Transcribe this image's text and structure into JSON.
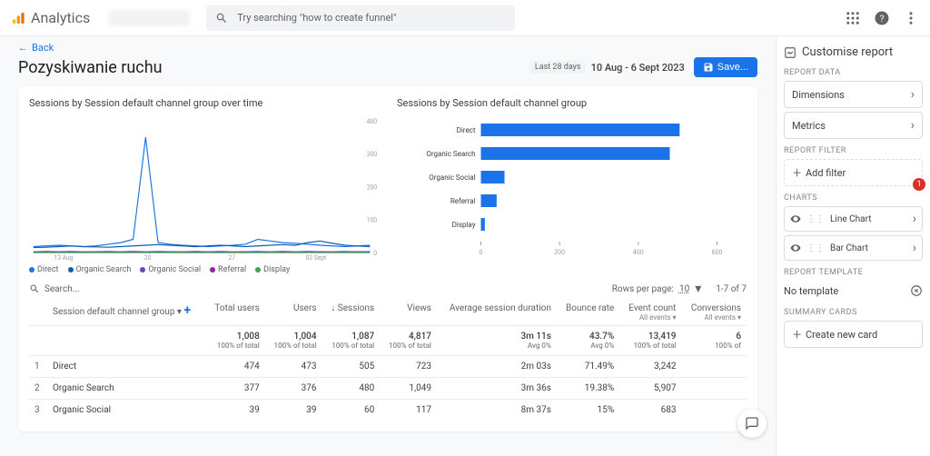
{
  "header": {
    "app_name": "Analytics",
    "search_placeholder": "Try searching \"how to create funnel\""
  },
  "nav": {
    "back_label": "Back"
  },
  "page": {
    "title": "Pozyskiwanie ruchu",
    "date_chip": "Last 28 days",
    "date_range": "10 Aug - 6 Sept 2023",
    "save_label": "Save..."
  },
  "charts": {
    "line_title": "Sessions by Session default channel group over time",
    "bar_title": "Sessions by Session default channel group",
    "legend": [
      "Direct",
      "Organic Search",
      "Organic Social",
      "Referral",
      "Display"
    ],
    "legend_colors": [
      "#1a73e8",
      "#0f5bb5",
      "#6f42c1",
      "#8e24aa",
      "#34a853"
    ]
  },
  "table": {
    "search_placeholder": "Search...",
    "rows_per_page_label": "Rows per page:",
    "rows_per_page_value": "10",
    "page_info": "1-7 of 7",
    "dimension_header": "Session default channel group",
    "columns": [
      "Total users",
      "Users",
      "↓ Sessions",
      "Views",
      "Average session duration",
      "Bounce rate",
      "Event count",
      "Conversions"
    ],
    "sub_headers": [
      "",
      "",
      "",
      "",
      "",
      "",
      "All events",
      "All events"
    ],
    "totals": {
      "values": [
        "1,008",
        "1,004",
        "1,087",
        "4,817",
        "3m 11s",
        "43.7%",
        "13,419",
        "6"
      ],
      "subs": [
        "100% of total",
        "100% of total",
        "100% of total",
        "100% of total",
        "Avg 0%",
        "Avg 0%",
        "100% of total",
        "100% of"
      ]
    },
    "rows": [
      {
        "idx": "1",
        "dim": "Direct",
        "vals": [
          "474",
          "473",
          "505",
          "723",
          "2m 03s",
          "71.49%",
          "3,242",
          ""
        ]
      },
      {
        "idx": "2",
        "dim": "Organic Search",
        "vals": [
          "377",
          "376",
          "480",
          "1,049",
          "3m 36s",
          "19.38%",
          "5,907",
          ""
        ]
      },
      {
        "idx": "3",
        "dim": "Organic Social",
        "vals": [
          "39",
          "39",
          "60",
          "117",
          "8m 37s",
          "15%",
          "683",
          ""
        ]
      }
    ]
  },
  "sidebar": {
    "title": "Customise report",
    "section_data": "REPORT DATA",
    "dimensions": "Dimensions",
    "metrics": "Metrics",
    "section_filter": "REPORT FILTER",
    "add_filter": "Add filter",
    "badge": "1",
    "section_charts": "CHARTS",
    "chart_line": "Line Chart",
    "chart_bar": "Bar Chart",
    "section_template": "REPORT TEMPLATE",
    "no_template": "No template",
    "section_summary": "SUMMARY CARDS",
    "create_card": "Create new card"
  },
  "chart_data": [
    {
      "type": "line",
      "title": "Sessions by Session default channel group over time",
      "xlabel": "",
      "ylabel": "",
      "ylim": [
        0,
        400
      ],
      "x_ticks": [
        "13 Aug",
        "20",
        "27",
        "03 Sept"
      ],
      "series": [
        {
          "name": "Direct",
          "color": "#1a73e8",
          "values": [
            18,
            20,
            22,
            20,
            18,
            20,
            25,
            30,
            40,
            350,
            30,
            25,
            22,
            20,
            18,
            20,
            22,
            25,
            40,
            35,
            30,
            28,
            25,
            22,
            20,
            18,
            20,
            22
          ]
        },
        {
          "name": "Organic Search",
          "color": "#0f5bb5",
          "values": [
            15,
            16,
            18,
            20,
            18,
            17,
            16,
            18,
            20,
            22,
            24,
            22,
            20,
            18,
            20,
            22,
            20,
            18,
            20,
            22,
            24,
            22,
            30,
            35,
            28,
            22,
            20,
            18
          ]
        },
        {
          "name": "Organic Social",
          "color": "#6f42c1",
          "values": [
            2,
            3,
            2,
            3,
            2,
            2,
            3,
            2,
            3,
            2,
            3,
            2,
            2,
            3,
            2,
            3,
            2,
            2,
            3,
            2,
            3,
            2,
            3,
            2,
            2,
            3,
            2,
            3
          ]
        },
        {
          "name": "Referral",
          "color": "#8e24aa",
          "values": [
            1,
            1,
            2,
            1,
            1,
            2,
            1,
            1,
            2,
            1,
            1,
            2,
            1,
            1,
            2,
            1,
            1,
            2,
            1,
            1,
            2,
            1,
            1,
            2,
            1,
            1,
            2,
            1
          ]
        },
        {
          "name": "Display",
          "color": "#34a853",
          "values": [
            0,
            0,
            0,
            0,
            0,
            0,
            0,
            0,
            0,
            0,
            0,
            0,
            0,
            0,
            0,
            0,
            0,
            0,
            0,
            0,
            0,
            0,
            0,
            0,
            0,
            0,
            0,
            0
          ]
        }
      ]
    },
    {
      "type": "bar",
      "title": "Sessions by Session default channel group",
      "orientation": "horizontal",
      "xlim": [
        0,
        600
      ],
      "x_ticks": [
        0,
        200,
        400,
        600
      ],
      "categories": [
        "Direct",
        "Organic Search",
        "Organic Social",
        "Referral",
        "Display"
      ],
      "values": [
        505,
        480,
        60,
        40,
        10
      ],
      "color": "#1a73e8"
    }
  ]
}
